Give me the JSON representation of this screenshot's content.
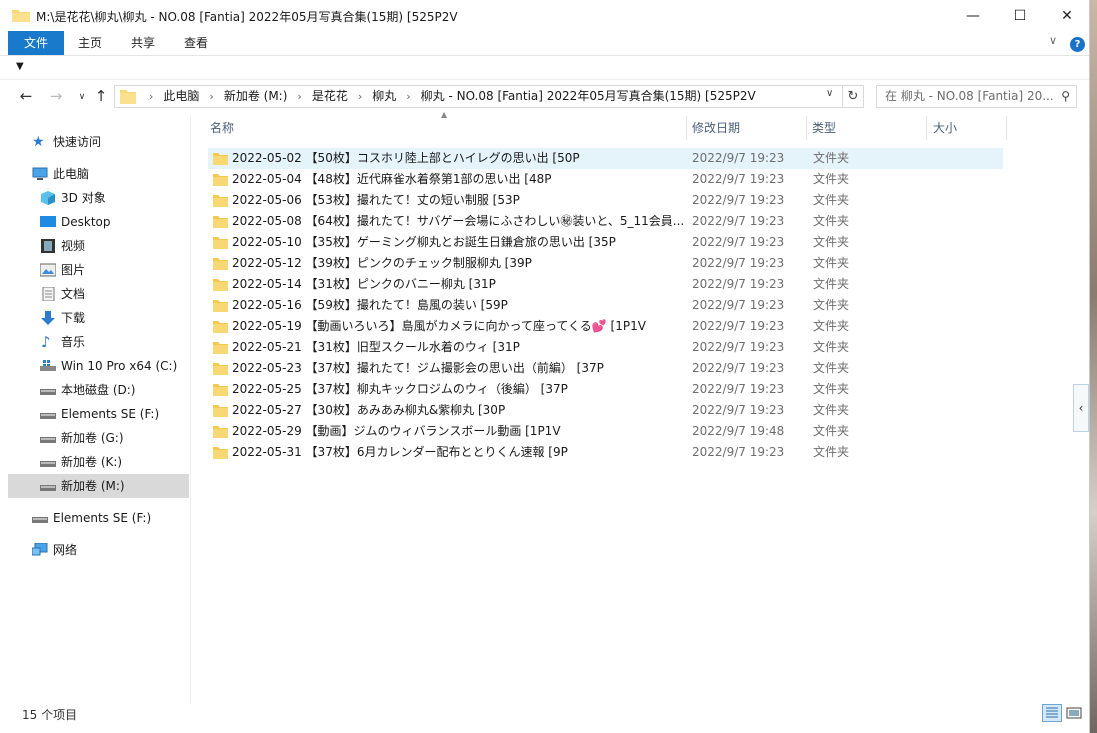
{
  "window": {
    "title": "M:\\是花花\\柳丸\\柳丸 - NO.08 [Fantia] 2022年05月写真合集(15期) [525P2V"
  },
  "ribbon": {
    "tabs": [
      "文件",
      "主页",
      "共享",
      "查看"
    ]
  },
  "address": {
    "crumbs": [
      "此电脑",
      "新加卷 (M:)",
      "是花花",
      "柳丸",
      "柳丸 - NO.08 [Fantia] 2022年05月写真合集(15期) [525P2V"
    ],
    "search_placeholder": "在 柳丸 - NO.08 [Fantia] 20..."
  },
  "sidebar": {
    "items": [
      {
        "label": "快速访问",
        "icon": "star-icon"
      },
      {
        "label": "此电脑",
        "icon": "computer-icon"
      },
      {
        "label": "3D 对象",
        "icon": "cube-icon"
      },
      {
        "label": "Desktop",
        "icon": "desktop-icon"
      },
      {
        "label": "视频",
        "icon": "film-icon"
      },
      {
        "label": "图片",
        "icon": "picture-icon"
      },
      {
        "label": "文档",
        "icon": "document-icon"
      },
      {
        "label": "下载",
        "icon": "download-icon"
      },
      {
        "label": "音乐",
        "icon": "music-icon"
      },
      {
        "label": "Win 10 Pro x64 (C:)",
        "icon": "windows-drive-icon"
      },
      {
        "label": "本地磁盘 (D:)",
        "icon": "drive-icon"
      },
      {
        "label": "Elements SE (F:)",
        "icon": "drive-icon"
      },
      {
        "label": "新加卷 (G:)",
        "icon": "drive-icon"
      },
      {
        "label": "新加卷 (K:)",
        "icon": "drive-icon"
      },
      {
        "label": "新加卷 (M:)",
        "icon": "drive-icon"
      },
      {
        "label": "Elements SE (F:)",
        "icon": "drive-icon"
      },
      {
        "label": "网络",
        "icon": "network-icon"
      }
    ]
  },
  "columns": {
    "name": "名称",
    "date": "修改日期",
    "type": "类型",
    "size": "大小"
  },
  "files": [
    {
      "name": "2022-05-02 【50枚】コスホリ陸上部とハイレグの思い出 [50P",
      "date": "2022/9/7 19:23",
      "type": "文件夹"
    },
    {
      "name": "2022-05-04 【48枚】近代麻雀水着祭第1部の思い出 [48P",
      "date": "2022/9/7 19:23",
      "type": "文件夹"
    },
    {
      "name": "2022-05-06 【53枚】撮れたて！丈の短い制服 [53P",
      "date": "2022/9/7 19:23",
      "type": "文件夹"
    },
    {
      "name": "2022-05-08 【64枚】撮れたて！サバゲー会場にふさわしい㊙装いと、5_11会員...",
      "date": "2022/9/7 19:23",
      "type": "文件夹"
    },
    {
      "name": "2022-05-10 【35枚】ゲーミング柳丸とお誕生日鎌倉旅の思い出 [35P",
      "date": "2022/9/7 19:23",
      "type": "文件夹"
    },
    {
      "name": "2022-05-12 【39枚】ピンクのチェック制服柳丸 [39P",
      "date": "2022/9/7 19:23",
      "type": "文件夹"
    },
    {
      "name": "2022-05-14 【31枚】ピンクのバニー柳丸 [31P",
      "date": "2022/9/7 19:23",
      "type": "文件夹"
    },
    {
      "name": "2022-05-16 【59枚】撮れたて！島風の装い [59P",
      "date": "2022/9/7 19:23",
      "type": "文件夹"
    },
    {
      "name": "2022-05-19 【動画いろいろ】島風がカメラに向かって座ってくる💕 [1P1V",
      "date": "2022/9/7 19:23",
      "type": "文件夹"
    },
    {
      "name": "2022-05-21 【31枚】旧型スクール水着のウィ [31P",
      "date": "2022/9/7 19:23",
      "type": "文件夹"
    },
    {
      "name": "2022-05-23 【37枚】撮れたて！ジム撮影会の思い出（前編） [37P",
      "date": "2022/9/7 19:23",
      "type": "文件夹"
    },
    {
      "name": "2022-05-25 【37枚】柳丸キックロジムのウィ（後編） [37P",
      "date": "2022/9/7 19:23",
      "type": "文件夹"
    },
    {
      "name": "2022-05-27 【30枚】あみあみ柳丸&紫柳丸 [30P",
      "date": "2022/9/7 19:23",
      "type": "文件夹"
    },
    {
      "name": "2022-05-29 【動画】ジムのウィバランスボール動画 [1P1V",
      "date": "2022/9/7 19:48",
      "type": "文件夹"
    },
    {
      "name": "2022-05-31 【37枚】6月カレンダー配布ととりくん速報 [9P",
      "date": "2022/9/7 19:23",
      "type": "文件夹"
    }
  ],
  "status": {
    "count": "15 个项目"
  },
  "colors": {
    "accent": "#1979ca",
    "folder": "#f8d775",
    "selected": "#d9d9d9",
    "hover": "#e5f3fb"
  }
}
